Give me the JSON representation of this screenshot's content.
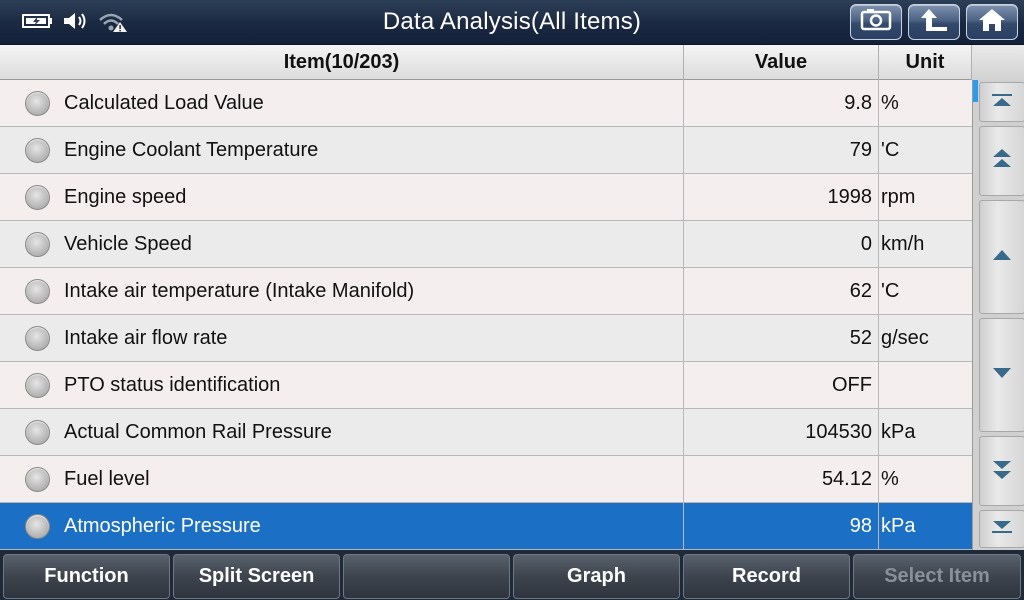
{
  "header": {
    "title": "Data Analysis(All Items)",
    "status_icons": [
      "battery-charging-icon",
      "speaker-icon",
      "wifi-warning-icon"
    ],
    "buttons": [
      "screenshot-icon",
      "back-upload-icon",
      "home-icon"
    ]
  },
  "table": {
    "columns": {
      "item": "Item(10/203)",
      "value": "Value",
      "unit": "Unit"
    },
    "rows": [
      {
        "item": "Calculated Load Value",
        "value": "9.8",
        "unit": "%"
      },
      {
        "item": "Engine Coolant Temperature",
        "value": "79",
        "unit": "'C"
      },
      {
        "item": "Engine speed",
        "value": "1998",
        "unit": "rpm"
      },
      {
        "item": "Vehicle Speed",
        "value": "0",
        "unit": "km/h"
      },
      {
        "item": "Intake air temperature (Intake Manifold)",
        "value": "62",
        "unit": "'C"
      },
      {
        "item": "Intake air flow rate",
        "value": "52",
        "unit": "g/sec"
      },
      {
        "item": "PTO status identification",
        "value": "OFF",
        "unit": ""
      },
      {
        "item": "Actual Common Rail Pressure",
        "value": "104530",
        "unit": "kPa"
      },
      {
        "item": "Fuel level",
        "value": "54.12",
        "unit": "%"
      },
      {
        "item": "Atmospheric Pressure",
        "value": "98",
        "unit": "kPa"
      }
    ],
    "selected_index": 9
  },
  "scroll_buttons": [
    "scroll-top-icon",
    "page-up-icon",
    "line-up-icon",
    "line-down-icon",
    "page-down-icon",
    "scroll-bottom-icon"
  ],
  "bottom_bar": {
    "function": "Function",
    "split_screen": "Split Screen",
    "empty": "",
    "graph": "Graph",
    "record": "Record",
    "select_item": "Select Item"
  },
  "colors": {
    "selected_row": "#1b6fc4",
    "header_bg": "#1a2940",
    "scroll_indicator": "#2a9cf0"
  }
}
